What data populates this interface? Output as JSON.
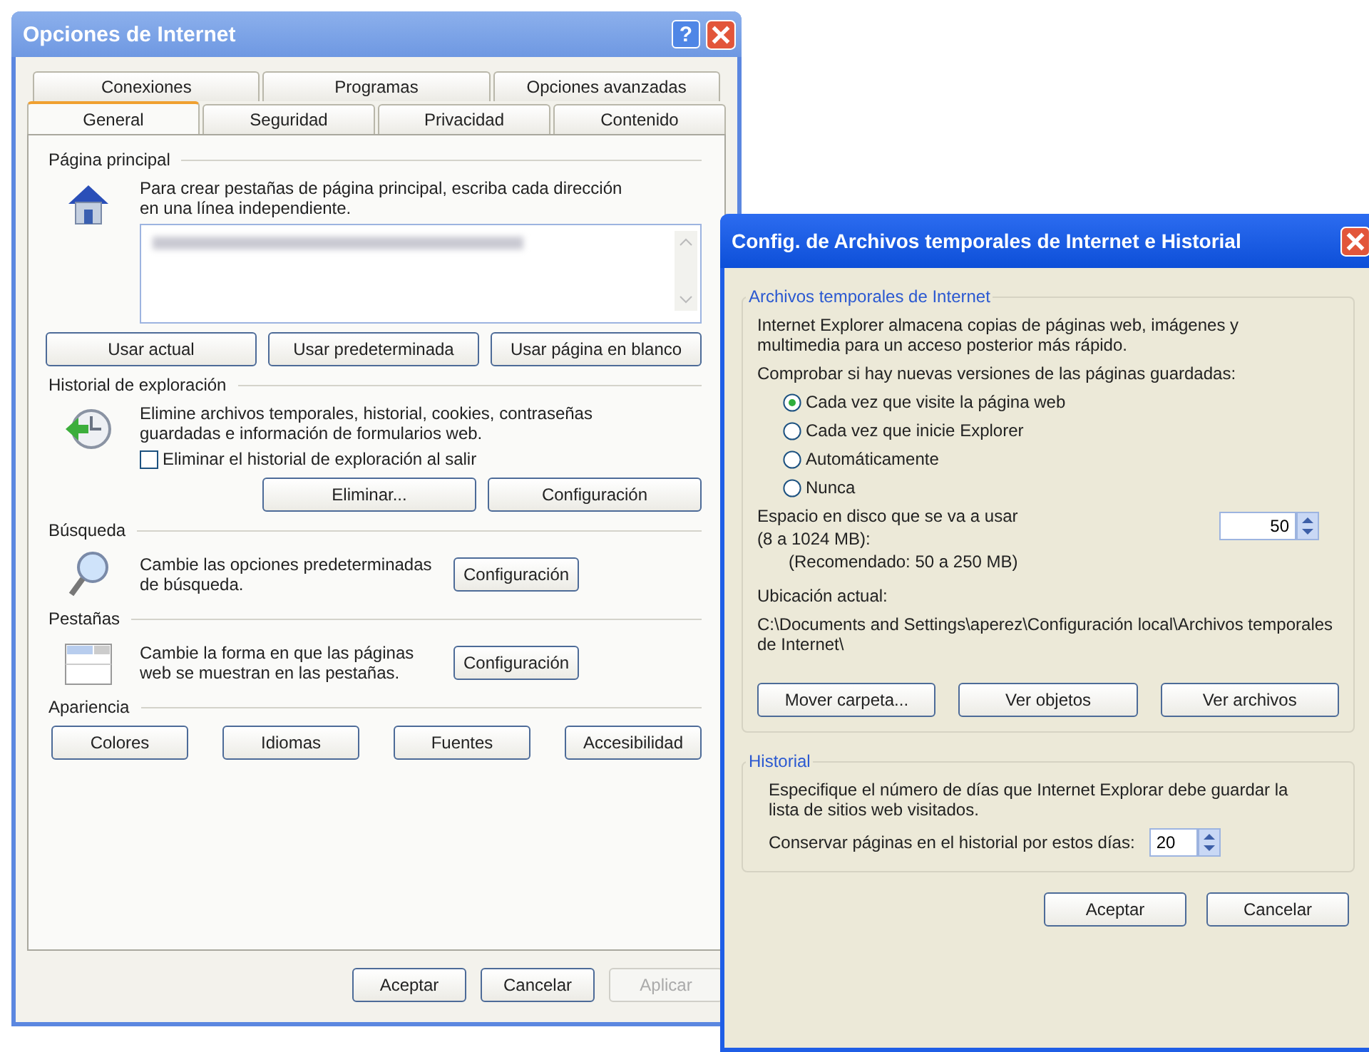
{
  "internet_options": {
    "title": "Opciones de Internet",
    "help_button": "?",
    "tabs_back": [
      {
        "label": "Conexiones",
        "selected": false
      },
      {
        "label": "Programas",
        "selected": false
      },
      {
        "label": "Opciones avanzadas",
        "selected": false
      }
    ],
    "tabs_front": [
      {
        "label": "General",
        "selected": true
      },
      {
        "label": "Seguridad",
        "selected": false
      },
      {
        "label": "Privacidad",
        "selected": false
      },
      {
        "label": "Contenido",
        "selected": false
      }
    ],
    "home_page": {
      "heading": "Página principal",
      "description": "Para crear pestañas de página principal, escriba cada dirección en una línea independiente.",
      "buttons": [
        "Usar actual",
        "Usar predeterminada",
        "Usar página en blanco"
      ]
    },
    "browsing_history": {
      "heading": "Historial de exploración",
      "description": "Elimine archivos temporales, historial, cookies, contraseñas guardadas e información de formularios web.",
      "delete_on_exit": {
        "label": "Eliminar el historial de exploración al salir",
        "checked": false
      },
      "buttons": [
        "Eliminar...",
        "Configuración"
      ]
    },
    "search": {
      "heading": "Búsqueda",
      "description": "Cambie las opciones predeterminadas de búsqueda.",
      "button": "Configuración"
    },
    "tabs_section": {
      "heading": "Pestañas",
      "description": "Cambie la forma en que las páginas web se muestran en las pestañas.",
      "button": "Configuración"
    },
    "appearance": {
      "heading": "Apariencia",
      "buttons": [
        "Colores",
        "Idiomas",
        "Fuentes",
        "Accesibilidad"
      ]
    },
    "footer_buttons": [
      {
        "label": "Aceptar",
        "disabled": false
      },
      {
        "label": "Cancelar",
        "disabled": false
      },
      {
        "label": "Aplicar",
        "disabled": true
      }
    ]
  },
  "temp_files_settings": {
    "title": "Config. de Archivos temporales de Internet e Historial",
    "temp_files": {
      "heading": "Archivos temporales de Internet",
      "description": "Internet Explorer almacena copias de páginas web, imágenes y multimedia para un acceso posterior más rápido.",
      "check_prompt": "Comprobar si hay nuevas versiones de las páginas guardadas:",
      "check_options": [
        {
          "label": "Cada vez que visite la página web",
          "selected": true
        },
        {
          "label": "Cada vez que inicie Explorer",
          "selected": false
        },
        {
          "label": "Automáticamente",
          "selected": false
        },
        {
          "label": "Nunca",
          "selected": false
        }
      ],
      "disk_space_label": "Espacio en disco que se va a usar",
      "disk_space_range": "(8 a 1024 MB):",
      "disk_space_recommended": "(Recomendado: 50 a 250 MB)",
      "disk_space_value": "50",
      "location_label": "Ubicación actual:",
      "location_path": "C:\\Documents and Settings\\aperez\\Configuración local\\Archivos temporales de Internet\\",
      "buttons": [
        "Mover carpeta...",
        "Ver objetos",
        "Ver archivos"
      ]
    },
    "history": {
      "heading": "Historial",
      "description": "Especifique el número de días que Internet Explorar debe guardar la lista de sitios web visitados.",
      "days_label": "Conservar páginas en el historial por estos días:",
      "days_value": "20"
    },
    "footer_buttons": [
      "Aceptar",
      "Cancelar"
    ]
  }
}
